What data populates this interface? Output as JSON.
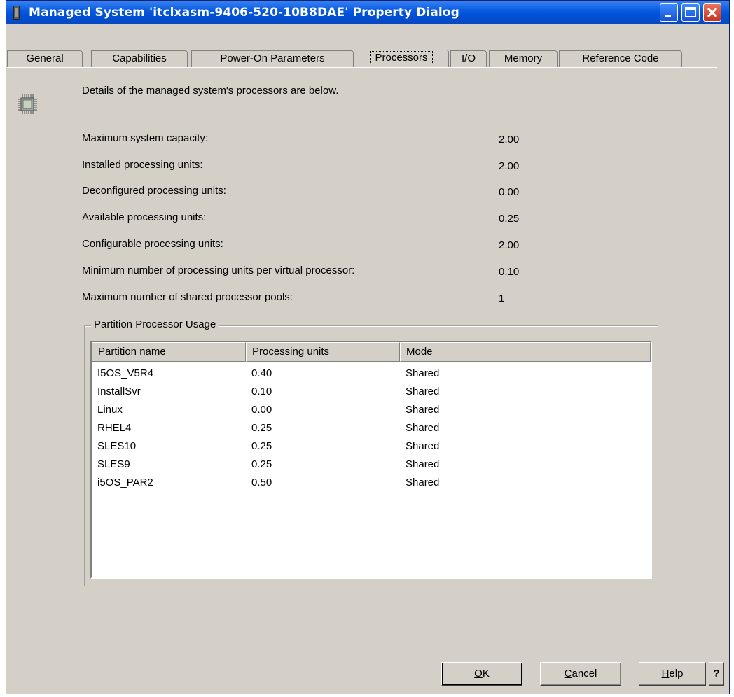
{
  "window": {
    "title": "Managed System 'itclxasm-9406-520-10B8DAE' Property Dialog"
  },
  "tabs": [
    {
      "label": "General"
    },
    {
      "label": "Capabilities"
    },
    {
      "label": "Power-On Parameters"
    },
    {
      "label": "Processors",
      "active": true
    },
    {
      "label": "I/O"
    },
    {
      "label": "Memory"
    },
    {
      "label": "Reference Code"
    }
  ],
  "description": "Details of the managed system's processors are below.",
  "properties": [
    {
      "label": "Maximum system capacity:",
      "value": "2.00"
    },
    {
      "label": "Installed processing units:",
      "value": "2.00"
    },
    {
      "label": "Deconfigured processing units:",
      "value": "0.00"
    },
    {
      "label": "Available processing units:",
      "value": "0.25"
    },
    {
      "label": "Configurable processing units:",
      "value": "2.00"
    },
    {
      "label": "Minimum number of processing units per virtual processor:",
      "value": "0.10"
    },
    {
      "label": "Maximum number of shared processor pools:",
      "value": "1"
    }
  ],
  "usage": {
    "title": "Partition Processor Usage",
    "columns": [
      "Partition name",
      "Processing units",
      "Mode"
    ],
    "rows": [
      [
        "I5OS_V5R4",
        "0.40",
        "Shared"
      ],
      [
        "InstallSvr",
        "0.10",
        "Shared"
      ],
      [
        "Linux",
        "0.00",
        "Shared"
      ],
      [
        "RHEL4",
        "0.25",
        "Shared"
      ],
      [
        "SLES10",
        "0.25",
        "Shared"
      ],
      [
        "SLES9",
        "0.25",
        "Shared"
      ],
      [
        "i5OS_PAR2",
        "0.50",
        "Shared"
      ]
    ]
  },
  "buttons": {
    "ok": {
      "mnemonic": "O",
      "rest": "K"
    },
    "cancel": {
      "mnemonic": "C",
      "rest": "ancel"
    },
    "help": {
      "mnemonic": "H",
      "rest": "elp"
    },
    "context_help": "?"
  }
}
